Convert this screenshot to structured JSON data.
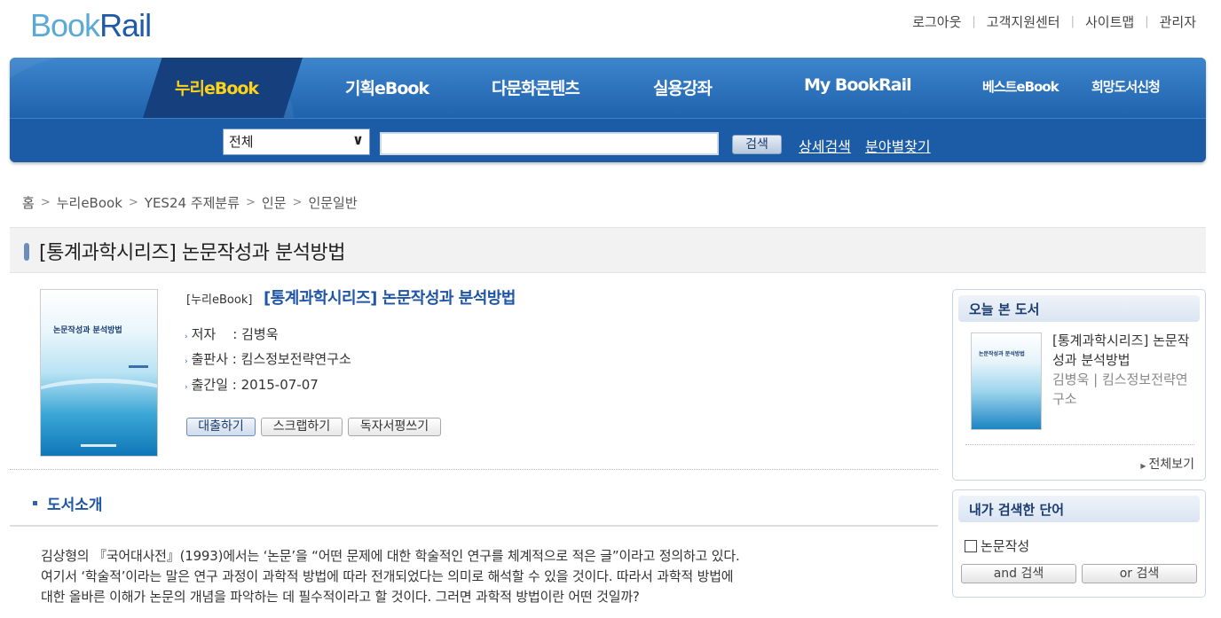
{
  "logo": {
    "part1": "Book",
    "part2": "Rail"
  },
  "toplinks": [
    "로그아웃",
    "고객지원센터",
    "사이트맵",
    "관리자"
  ],
  "nav": {
    "items": [
      "누리eBook",
      "기획eBook",
      "다문화콘텐츠",
      "실용강좌",
      "My BookRail"
    ],
    "extra": [
      "베스트eBook",
      "희망도서신청"
    ],
    "active": "누리eBook"
  },
  "search": {
    "category": "전체",
    "query": "",
    "button": "검색",
    "links": [
      "상세검색",
      "분야별찾기"
    ]
  },
  "breadcrumb": [
    "홈",
    "누리eBook",
    "YES24 주제분류",
    "인문",
    "인문일반"
  ],
  "page_title": "[통계과학시리즈] 논문작성과 분석방법",
  "book": {
    "cover_text": "논문작성과 분석방법",
    "category": "[누리eBook]",
    "title": "[통계과학시리즈] 논문작성과 분석방법",
    "author_label": "저자",
    "author": "김병욱",
    "publisher_label": "출판사",
    "publisher": "킴스정보전략연구소",
    "date_label": "출간일",
    "date": "2015-07-07",
    "buttons": [
      "대출하기",
      "스크랩하기",
      "독자서평쓰기"
    ]
  },
  "intro": {
    "heading": "도서소개",
    "lines": [
      "김상형의 『국어대사전』(1993)에서는 ‘논문’을 “어떤 문제에 대한 학술적인 연구를 체계적으로 적은 글”이라고 정의하고 있다.",
      "여기서 ‘학술적’이라는 말은 연구 과정이 과학적 방법에 따라 전개되었다는 의미로 해석할 수 있을 것이다. 따라서 과학적 방법에",
      "대한 올바른 이해가 논문의 개념을 파악하는 데 필수적이라고 할 것이다. 그러면 과학적 방법이란 어떤 것일까?"
    ]
  },
  "sidebar": {
    "today": {
      "heading": "오늘 본 도서",
      "title": "[통계과학시리즈] 논문작성과 분석방법",
      "author_pub": "김병욱 | 킴스정보전략연구소",
      "view_all": "전체보기"
    },
    "searched": {
      "heading": "내가 검색한 단어",
      "term": "논문작성",
      "and_btn": "and 검색",
      "or_btn": "or 검색"
    }
  },
  "colors": {
    "nav_bg": "#1f62ad",
    "active_menu": "#ffd21a",
    "title_link": "#1e55a6"
  }
}
